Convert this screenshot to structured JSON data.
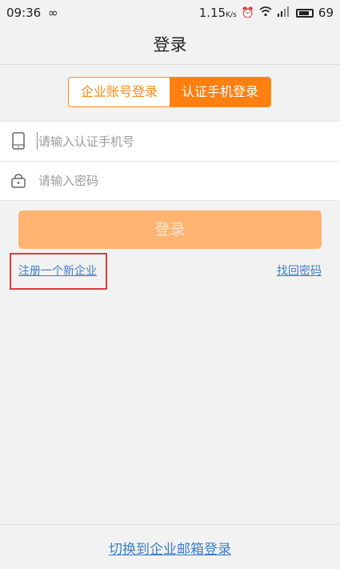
{
  "status_bar": {
    "time": "09:36",
    "link_glyph": "∞",
    "speed": "1.15",
    "speed_unit": "K/s",
    "battery_level": "69"
  },
  "header": {
    "title": "登录"
  },
  "tabs": [
    {
      "label": "企业账号登录",
      "active": false
    },
    {
      "label": "认证手机登录",
      "active": true
    }
  ],
  "form": {
    "phone_placeholder": "请输入认证手机号",
    "password_placeholder": "请输入密码"
  },
  "login_button": "登录",
  "links": {
    "register": "注册一个新企业",
    "forgot_password": "找回密码"
  },
  "footer": {
    "switch_label": "切换到企业邮箱登录"
  },
  "colors": {
    "accent": "#ff7f11",
    "button_disabled": "#ffb472",
    "link": "#3d7ec6",
    "highlight_box": "#e0393e"
  }
}
